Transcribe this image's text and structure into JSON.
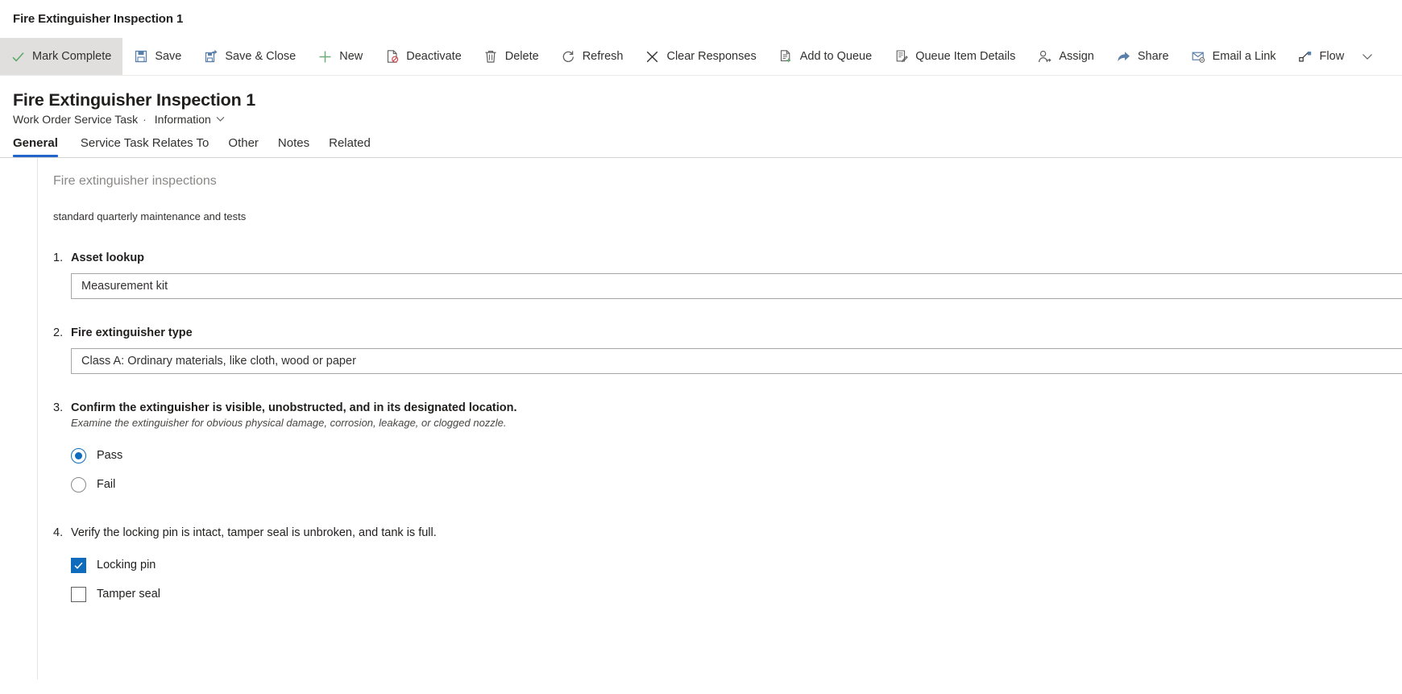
{
  "window": {
    "title": "Fire Extinguisher Inspection 1"
  },
  "commandbar": {
    "items": [
      {
        "label": "Mark Complete",
        "icon": "checkmark-icon",
        "highlighted": true
      },
      {
        "label": "Save",
        "icon": "save-icon",
        "highlighted": false
      },
      {
        "label": "Save & Close",
        "icon": "save-and-close-icon",
        "highlighted": false
      },
      {
        "label": "New",
        "icon": "plus-icon",
        "highlighted": false
      },
      {
        "label": "Deactivate",
        "icon": "deactivate-icon",
        "highlighted": false
      },
      {
        "label": "Delete",
        "icon": "trash-icon",
        "highlighted": false
      },
      {
        "label": "Refresh",
        "icon": "refresh-icon",
        "highlighted": false
      },
      {
        "label": "Clear Responses",
        "icon": "close-x-icon",
        "highlighted": false
      },
      {
        "label": "Add to Queue",
        "icon": "add-to-queue-icon",
        "highlighted": false
      },
      {
        "label": "Queue Item Details",
        "icon": "queue-item-details-icon",
        "highlighted": false
      },
      {
        "label": "Assign",
        "icon": "assign-person-icon",
        "highlighted": false
      },
      {
        "label": "Share",
        "icon": "share-icon",
        "highlighted": false
      },
      {
        "label": "Email a Link",
        "icon": "email-link-icon",
        "highlighted": false
      },
      {
        "label": "Flow",
        "icon": "flow-icon",
        "highlighted": false
      }
    ],
    "overflow_icon": "chevron-down-icon"
  },
  "header": {
    "title": "Fire Extinguisher Inspection 1",
    "entity": "Work Order Service Task",
    "separator": "·",
    "form_name": "Information",
    "form_chevron": "chevron-down-icon"
  },
  "tabs": [
    {
      "label": "General",
      "active": true
    },
    {
      "label": "Service Task Relates To",
      "active": false
    },
    {
      "label": "Other",
      "active": false
    },
    {
      "label": "Notes",
      "active": false
    },
    {
      "label": "Related",
      "active": false
    }
  ],
  "form": {
    "section_title": "Fire extinguisher inspections",
    "section_description": "standard quarterly maintenance and tests",
    "questions": [
      {
        "number": "1.",
        "label": "Asset lookup",
        "bold": false,
        "hint": "",
        "type": "text",
        "value": "Measurement kit"
      },
      {
        "number": "2.",
        "label": "Fire extinguisher type",
        "bold": true,
        "hint": "",
        "type": "text",
        "value": "Class A: Ordinary materials, like cloth, wood or paper"
      },
      {
        "number": "3.",
        "label": "Confirm the extinguisher is visible, unobstructed, and in its designated location.",
        "bold": true,
        "hint": "Examine the extinguisher for obvious physical damage, corrosion, leakage, or clogged nozzle.",
        "type": "radio",
        "options": [
          {
            "label": "Pass",
            "checked": true
          },
          {
            "label": "Fail",
            "checked": false
          }
        ]
      },
      {
        "number": "4.",
        "label": "Verify the locking pin is intact, tamper seal is unbroken, and tank is full.",
        "bold": false,
        "hint": "",
        "type": "checkbox",
        "options": [
          {
            "label": "Locking pin",
            "checked": true
          },
          {
            "label": "Tamper seal",
            "checked": false
          }
        ]
      }
    ]
  },
  "colors": {
    "accent": "#2266cc",
    "checked": "#0f6cbd",
    "green": "#5aa865",
    "blue_icon": "#5a7fa8",
    "highlight_bg": "#e1dfdd"
  }
}
